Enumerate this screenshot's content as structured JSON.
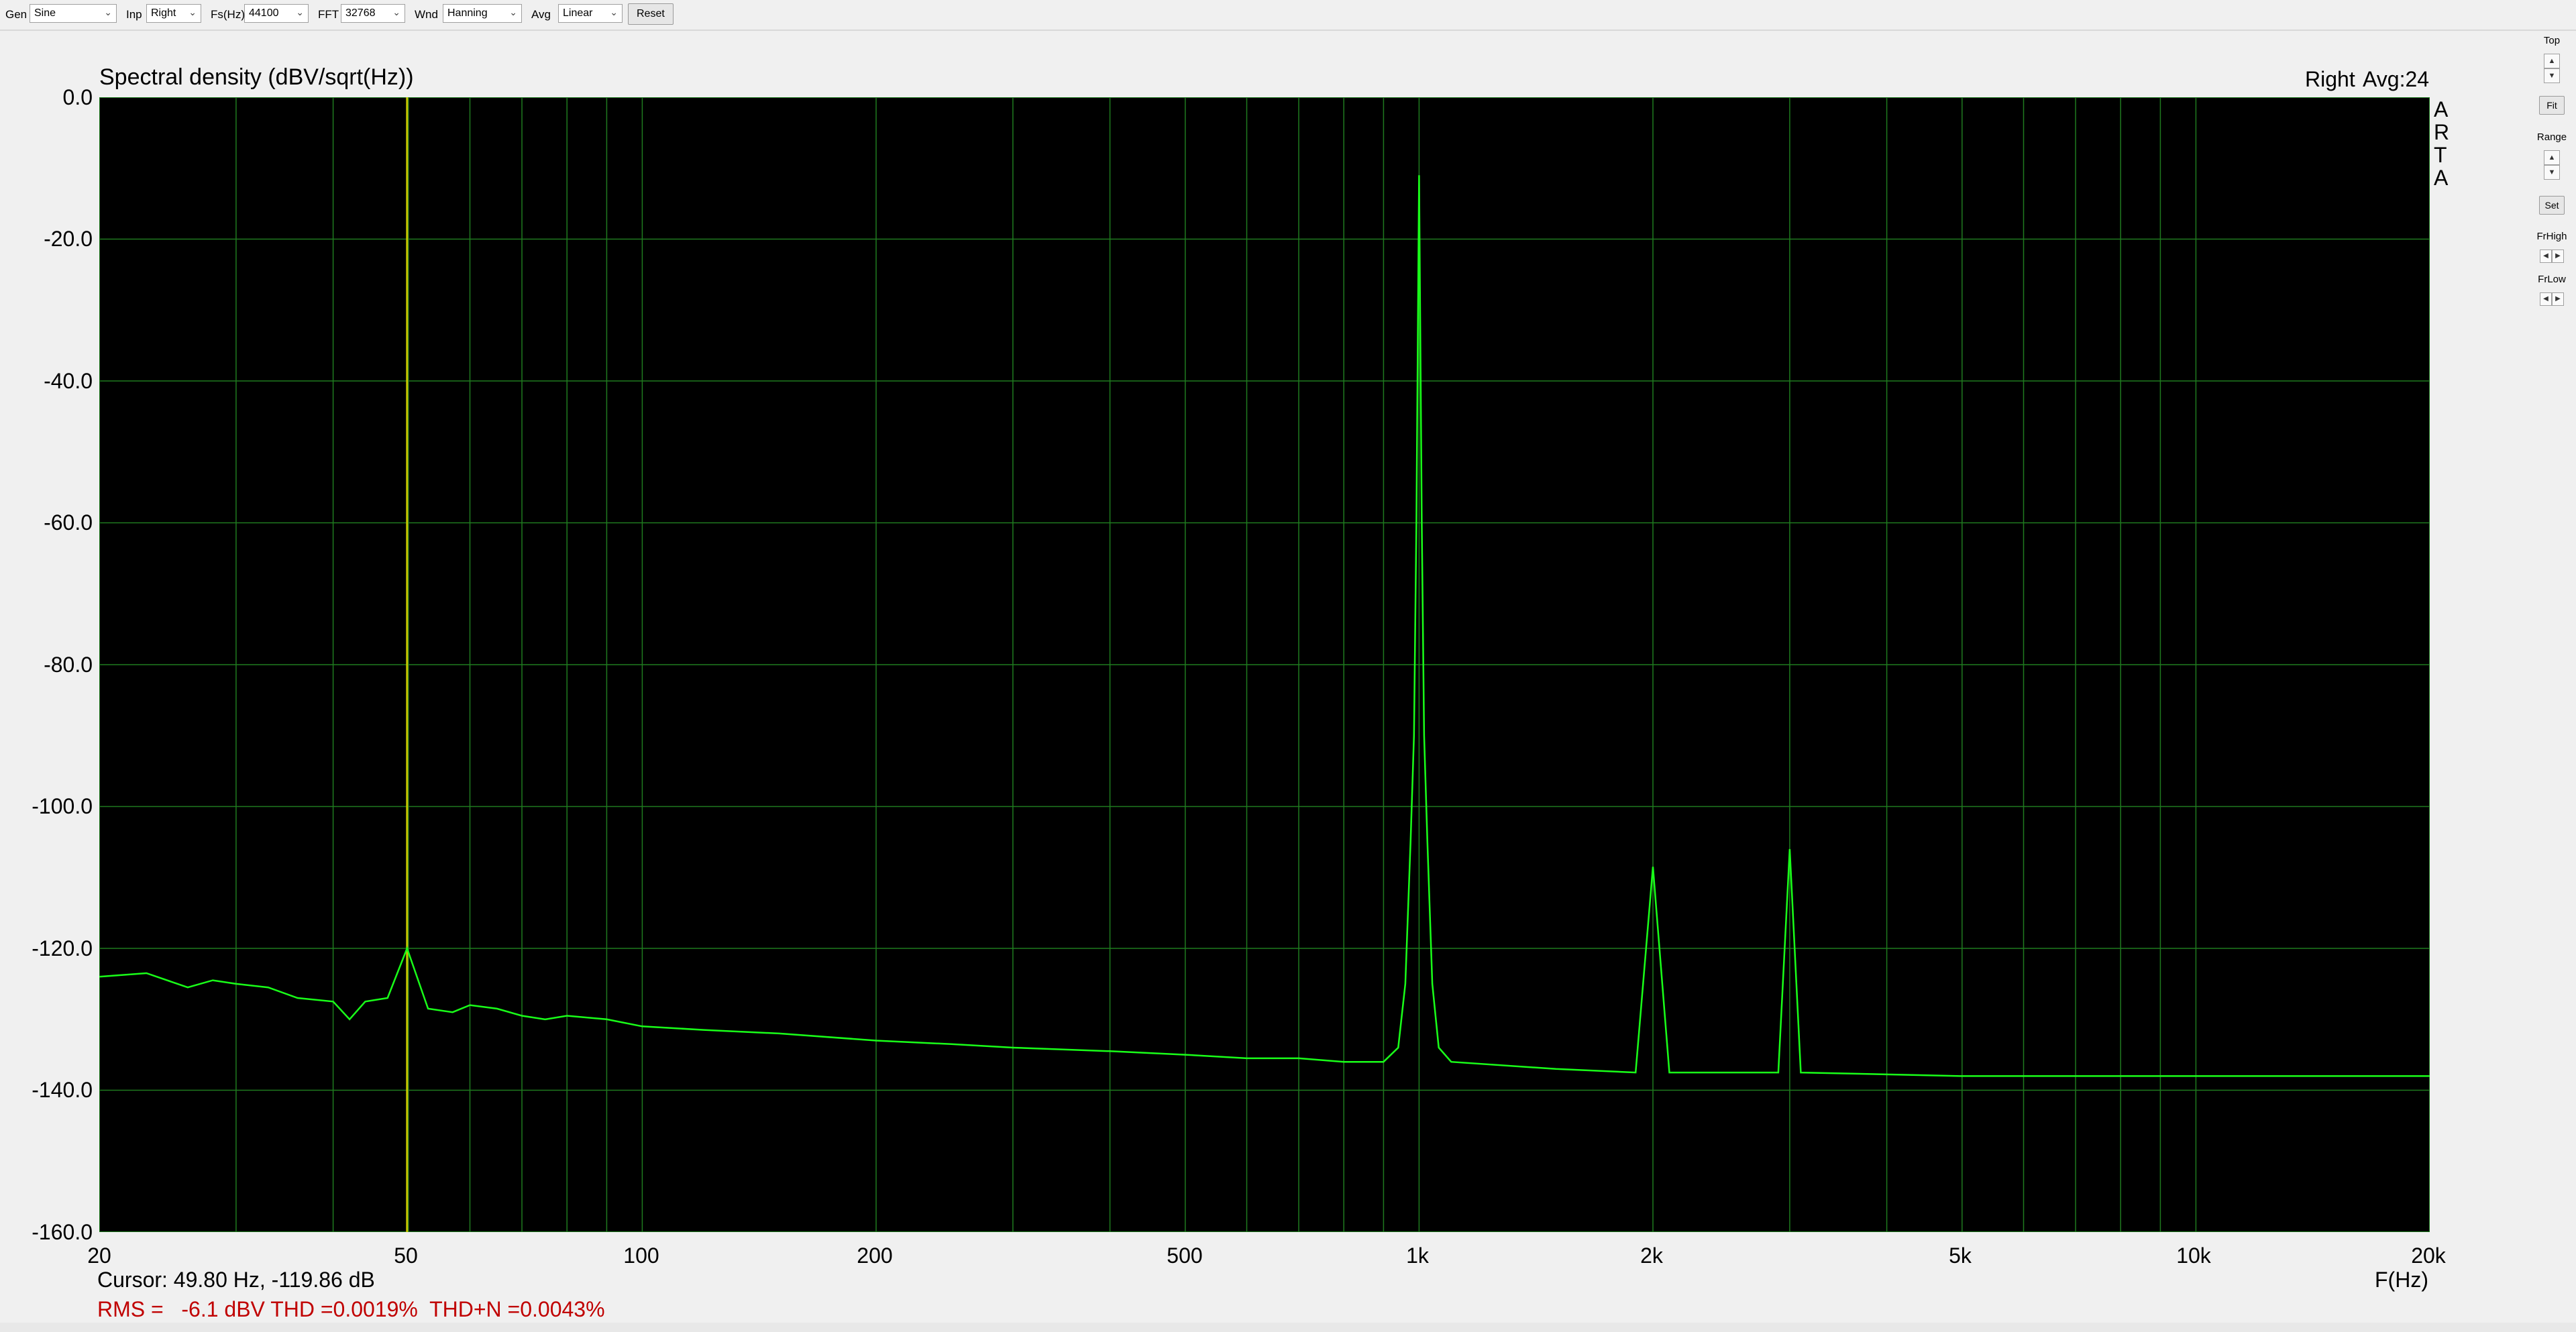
{
  "toolbar": {
    "gen_label": "Gen",
    "gen_value": "Sine",
    "inp_label": "Inp",
    "inp_value": "Right",
    "fs_label": "Fs(Hz)",
    "fs_value": "44100",
    "fft_label": "FFT",
    "fft_value": "32768",
    "wnd_label": "Wnd",
    "wnd_value": "Hanning",
    "avg_label": "Avg",
    "avg_value": "Linear",
    "reset_label": "Reset"
  },
  "right_panel": {
    "top_label": "Top",
    "fit_label": "Fit",
    "range_label": "Range",
    "set_label": "Set",
    "frhigh_label": "FrHigh",
    "frlow_label": "FrLow"
  },
  "graph": {
    "title": "Spectral density (dBV/sqrt(Hz))",
    "channel": "Right",
    "avg_text": "Avg:24",
    "arta_letters": [
      "A",
      "R",
      "T",
      "A"
    ],
    "x_axis_label": "F(Hz)",
    "cursor_text": "Cursor: 49.80 Hz, -119.86 dB",
    "rms_text": "RMS =   -6.1 dBV THD =0.0019%  THD+N =0.0043%",
    "colors": {
      "background": "#000000",
      "grid": "#1f7a1f",
      "trace": "#19ff19",
      "cursor": "#c8c800",
      "rms_text": "#c00000"
    }
  },
  "chart_data": {
    "type": "line",
    "title": "Spectral density (dBV/sqrt(Hz))",
    "xlabel": "F(Hz)",
    "ylabel": "",
    "x_scale": "log",
    "xlim": [
      20,
      20000
    ],
    "ylim": [
      -160,
      0
    ],
    "grid": true,
    "x_ticks": [
      {
        "value": 20,
        "label": "20"
      },
      {
        "value": 50,
        "label": "50"
      },
      {
        "value": 100,
        "label": "100"
      },
      {
        "value": 200,
        "label": "200"
      },
      {
        "value": 500,
        "label": "500"
      },
      {
        "value": 1000,
        "label": "1k"
      },
      {
        "value": 2000,
        "label": "2k"
      },
      {
        "value": 5000,
        "label": "5k"
      },
      {
        "value": 10000,
        "label": "10k"
      },
      {
        "value": 20000,
        "label": "20k"
      }
    ],
    "y_ticks": [
      {
        "value": 0,
        "label": "0.0"
      },
      {
        "value": -20,
        "label": "-20.0"
      },
      {
        "value": -40,
        "label": "-40.0"
      },
      {
        "value": -60,
        "label": "-60.0"
      },
      {
        "value": -80,
        "label": "-80.0"
      },
      {
        "value": -100,
        "label": "-100.0"
      },
      {
        "value": -120,
        "label": "-120.0"
      },
      {
        "value": -140,
        "label": "-140.0"
      },
      {
        "value": -160,
        "label": "-160.0"
      }
    ],
    "cursor": {
      "x": 49.8,
      "y": -119.86
    },
    "series": [
      {
        "values": [
          [
            20,
            -124
          ],
          [
            23,
            -123.5
          ],
          [
            26,
            -125.5
          ],
          [
            28,
            -124.5
          ],
          [
            30,
            -125
          ],
          [
            33,
            -125.5
          ],
          [
            36,
            -127
          ],
          [
            40,
            -127.5
          ],
          [
            42,
            -130
          ],
          [
            44,
            -127.5
          ],
          [
            47,
            -127
          ],
          [
            49.8,
            -120
          ],
          [
            53,
            -128.5
          ],
          [
            57,
            -129
          ],
          [
            60,
            -128
          ],
          [
            65,
            -128.5
          ],
          [
            70,
            -129.5
          ],
          [
            75,
            -130
          ],
          [
            80,
            -129.5
          ],
          [
            90,
            -130
          ],
          [
            100,
            -131
          ],
          [
            120,
            -131.5
          ],
          [
            150,
            -132
          ],
          [
            200,
            -133
          ],
          [
            250,
            -133.5
          ],
          [
            300,
            -134
          ],
          [
            400,
            -134.5
          ],
          [
            500,
            -135
          ],
          [
            600,
            -135.5
          ],
          [
            700,
            -135.5
          ],
          [
            800,
            -136
          ],
          [
            900,
            -136
          ],
          [
            940,
            -134
          ],
          [
            960,
            -125
          ],
          [
            975,
            -105
          ],
          [
            985,
            -90
          ],
          [
            992,
            -60
          ],
          [
            1000,
            -11
          ],
          [
            1008,
            -60
          ],
          [
            1015,
            -90
          ],
          [
            1025,
            -105
          ],
          [
            1040,
            -125
          ],
          [
            1060,
            -134
          ],
          [
            1100,
            -136
          ],
          [
            1500,
            -137
          ],
          [
            1900,
            -137.5
          ],
          [
            2000,
            -108.5
          ],
          [
            2100,
            -137.5
          ],
          [
            2900,
            -137.5
          ],
          [
            3000,
            -106
          ],
          [
            3100,
            -137.5
          ],
          [
            5000,
            -138
          ],
          [
            7000,
            -138
          ],
          [
            10000,
            -138
          ],
          [
            15000,
            -138
          ],
          [
            20000,
            -138
          ]
        ]
      }
    ]
  }
}
